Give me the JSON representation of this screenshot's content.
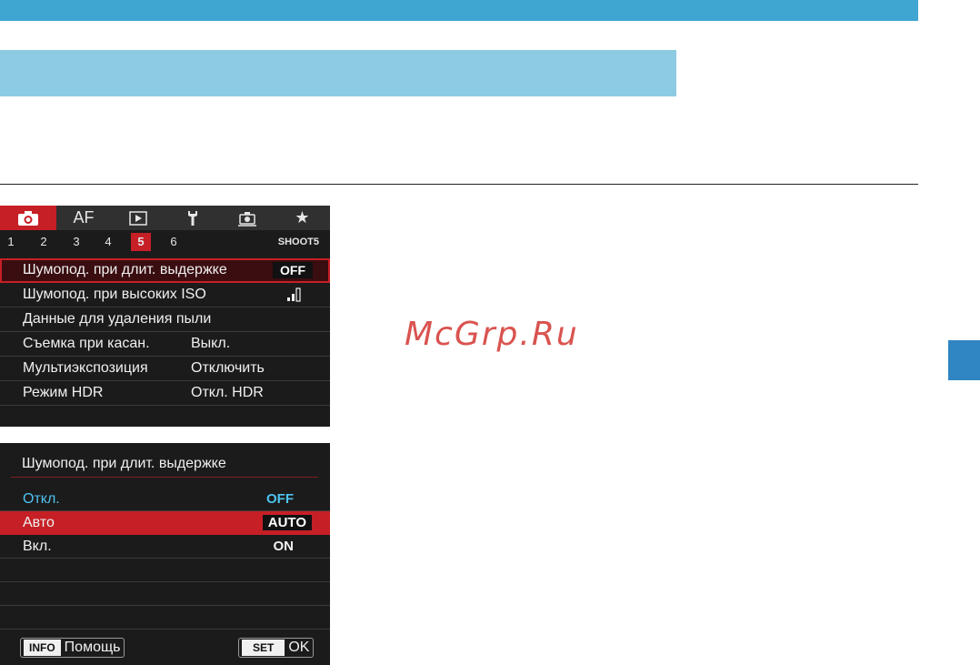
{
  "watermark": "McGrp.Ru",
  "screen1": {
    "tabs": [
      {
        "icon": "camera-icon",
        "glyph": "",
        "active": true
      },
      {
        "icon": "af-tab",
        "glyph": "AF",
        "active": false
      },
      {
        "icon": "playback-icon",
        "glyph": "▶",
        "active": false
      },
      {
        "icon": "wrench-icon",
        "glyph": "Y",
        "active": false
      },
      {
        "icon": "custom-function-icon",
        "glyph": "",
        "active": false
      },
      {
        "icon": "star-icon",
        "glyph": "★",
        "active": false
      }
    ],
    "page_numbers": [
      "1",
      "2",
      "3",
      "4",
      "5",
      "6"
    ],
    "active_page": "5",
    "shoot_label": "SHOOT5",
    "items": [
      {
        "label": "Шумопод. при длит. выдержке",
        "value": "OFF"
      },
      {
        "label": "Шумопод. при высоких ISO",
        "value": ""
      },
      {
        "label": "Данные для удаления пыли",
        "value": ""
      },
      {
        "label": "Съемка при касан.",
        "value": "Выкл."
      },
      {
        "label": "Мультиэкспозиция",
        "value": "Отключить"
      },
      {
        "label": "Режим HDR",
        "value": "Откл. HDR"
      }
    ]
  },
  "screen2": {
    "title": "Шумопод. при длит. выдержке",
    "options": [
      {
        "label": "Откл.",
        "value": "OFF"
      },
      {
        "label": "Авто",
        "value": "AUTO"
      },
      {
        "label": "Вкл.",
        "value": "ON"
      }
    ],
    "footer": {
      "info_key": "INFO",
      "info_label": "Помощь",
      "set_key": "SET",
      "set_label": "OK"
    }
  },
  "colors": {
    "accent_red": "#c61f26",
    "header_blue": "#3ea6d1",
    "sub_blue": "#8dcbe2",
    "current_cyan": "#4ec3f0"
  }
}
